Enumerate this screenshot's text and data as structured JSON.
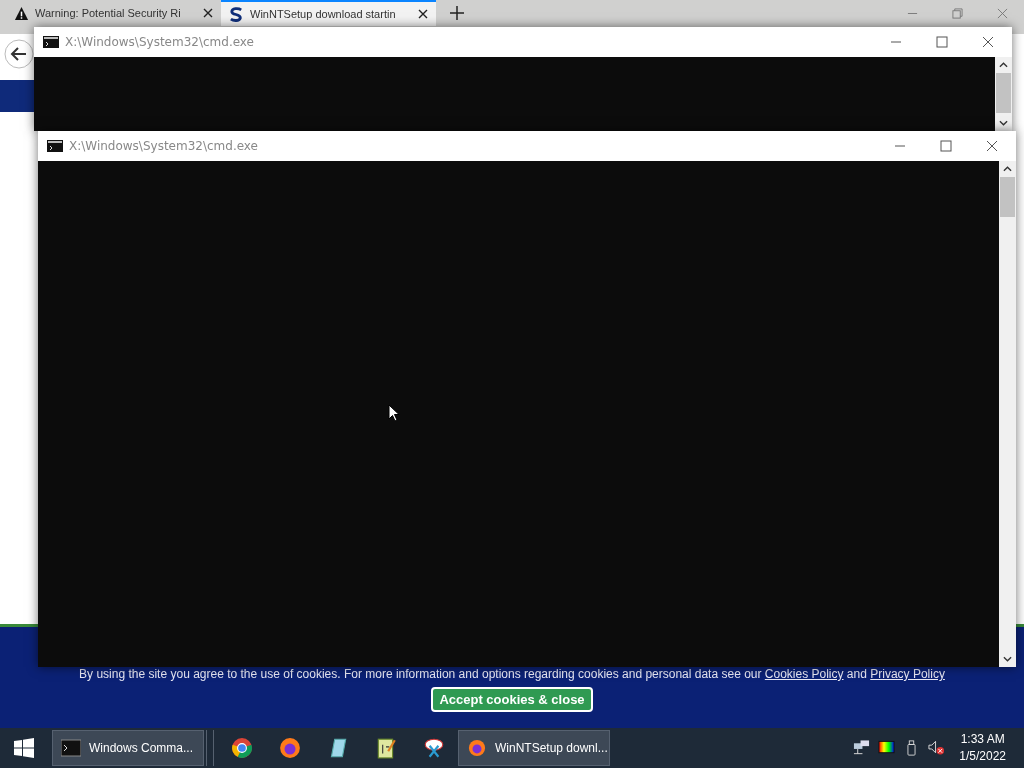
{
  "browser": {
    "tabs": [
      {
        "title": "Warning: Potential Security Ri",
        "kind": "warning",
        "selected": false
      },
      {
        "title": "WinNTSetup download startin",
        "kind": "site",
        "selected": true
      }
    ],
    "cookie_banner": {
      "text": "By using the site you agree to the use of cookies. For more information and options regarding cookies and personal data see our",
      "links": [
        "Cookies Policy",
        "Privacy Policy"
      ],
      "conjunction": "and",
      "button": "Accept cookies & close"
    }
  },
  "windows": [
    {
      "title": "X:\\Windows\\System32\\cmd.exe"
    },
    {
      "title": "X:\\Windows\\System32\\cmd.exe"
    }
  ],
  "taskbar": {
    "items": [
      {
        "kind": "window",
        "label": "Windows Comma..."
      },
      {
        "kind": "pinned"
      },
      {
        "kind": "pinned"
      },
      {
        "kind": "pinned"
      },
      {
        "kind": "pinned"
      },
      {
        "kind": "pinned"
      },
      {
        "kind": "window",
        "label": "WinNTSetup downl..."
      }
    ],
    "clock": {
      "time": "1:33 AM",
      "date": "1/5/2022"
    }
  }
}
